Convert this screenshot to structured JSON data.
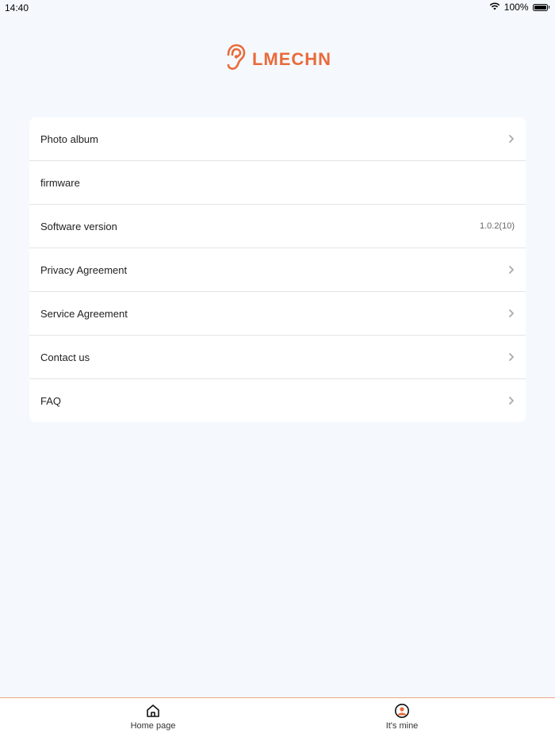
{
  "status_bar": {
    "time": "14:40",
    "battery": "100%",
    "battery_level": 1.0,
    "wifi_icon": "wifi-icon",
    "battery_icon": "battery-icon"
  },
  "brand": {
    "name": "LMECHN",
    "icon": "ear-logo-icon",
    "color": "#ea6a3a"
  },
  "menu": {
    "items": [
      {
        "label": "Photo album",
        "value": "",
        "chevron": true
      },
      {
        "label": "firmware",
        "value": "",
        "chevron": false
      },
      {
        "label": "Software version",
        "value": "1.0.2(10)",
        "chevron": false
      },
      {
        "label": "Privacy Agreement",
        "value": "",
        "chevron": true
      },
      {
        "label": "Service Agreement",
        "value": "",
        "chevron": true
      },
      {
        "label": "Contact us",
        "value": "",
        "chevron": true
      },
      {
        "label": "FAQ",
        "value": "",
        "chevron": true
      }
    ]
  },
  "tab_bar": {
    "tabs": [
      {
        "label": "Home page",
        "icon": "home-icon",
        "active": false
      },
      {
        "label": "It's mine",
        "icon": "profile-icon",
        "active": true
      }
    ],
    "accent_color": "#ea6a3a"
  }
}
